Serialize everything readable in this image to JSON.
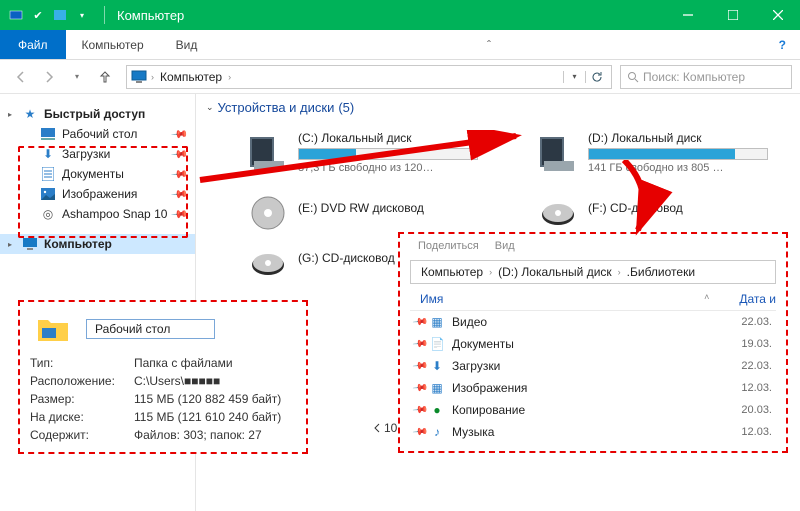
{
  "window": {
    "title": "Компьютер"
  },
  "ribbon": {
    "file": "Файл",
    "computer": "Компьютер",
    "view": "Вид"
  },
  "address": {
    "root": "Компьютер"
  },
  "search": {
    "placeholder": "Поиск: Компьютер"
  },
  "sidebar": {
    "quick": "Быстрый доступ",
    "items": [
      {
        "label": "Рабочий стол"
      },
      {
        "label": "Загрузки"
      },
      {
        "label": "Документы"
      },
      {
        "label": "Изображения"
      },
      {
        "label": "Ashampoo Snap 10"
      }
    ],
    "computer": "Компьютер"
  },
  "section": {
    "title": "Устройства и диски",
    "count": "(5)"
  },
  "drives": {
    "c": {
      "name": "(C:) Локальный диск",
      "free": "87,3 ГБ свободно из 120…",
      "fill_pct": 32
    },
    "d": {
      "name": "(D:) Локальный диск",
      "free": "141 ГБ свободно из 805 …",
      "fill_pct": 82
    },
    "e": {
      "name": "(E:) DVD RW дисковод"
    },
    "f": {
      "name": "(F:) CD-дисковод"
    },
    "g": {
      "name": "(G:) CD-дисковод"
    }
  },
  "props": {
    "folder_name": "Рабочий стол",
    "rows": [
      {
        "k": "Тип:",
        "v": "Папка с файлами"
      },
      {
        "k": "Расположение:",
        "v": "C:\\Users\\■■■■■"
      },
      {
        "k": "Размер:",
        "v": "115 МБ (120 882 459 байт)"
      },
      {
        "k": "На диске:",
        "v": "115 МБ (121 610 240 байт)"
      },
      {
        "k": "Содержит:",
        "v": "Файлов: 303; папок: 27"
      }
    ]
  },
  "inner": {
    "tab1": "Поделиться",
    "tab2": "Вид",
    "crumbs": [
      "Компьютер",
      "(D:) Локальный диск",
      ".Библиотеки"
    ],
    "hdr_name": "Имя",
    "hdr_date": "Дата и",
    "count": "10",
    "rows": [
      {
        "label": "Видео",
        "date": "22.03.",
        "color": "#2b7ec8"
      },
      {
        "label": "Документы",
        "date": "19.03.",
        "color": "#e07e22"
      },
      {
        "label": "Загрузки",
        "date": "22.03.",
        "color": "#2b7ec8"
      },
      {
        "label": "Изображения",
        "date": "12.03.",
        "color": "#2b7ec8"
      },
      {
        "label": "Копирование",
        "date": "20.03.",
        "color": "#0a8a2a"
      },
      {
        "label": "Музыка",
        "date": "12.03.",
        "color": "#2b7ec8"
      }
    ]
  }
}
